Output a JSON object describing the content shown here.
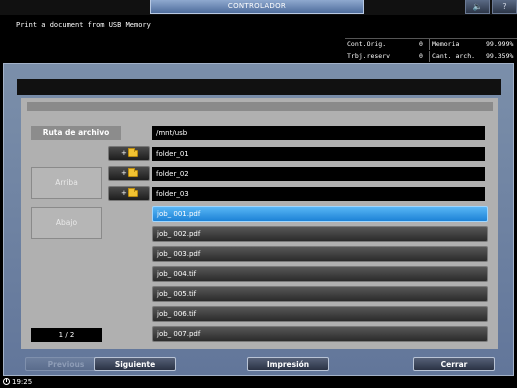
{
  "top_bar": {
    "tab_title": "CONTROLADOR",
    "volume_icon": "speaker-icon",
    "volume_symbol": "🔈",
    "help_symbol": "?"
  },
  "message": "Print a document from USB Memory",
  "status": {
    "rows": [
      {
        "label": "Cont.Orig.",
        "value": "0",
        "label2": "Memoria",
        "value2": "99.999%"
      },
      {
        "label": "Trbj.reserv",
        "value": "0",
        "label2": "Cant. arch.",
        "value2": "99.359%"
      }
    ]
  },
  "browser": {
    "path_label": "Ruta de archivo",
    "path": "/mnt/usb",
    "up_label": "Arriba",
    "down_label": "Abajo",
    "page_indicator": "1 / 2",
    "folder_button_arrow": "+",
    "folders": [
      "folder_01",
      "folder_02",
      "folder_03"
    ],
    "files": [
      {
        "name": "job_ 001.pdf",
        "selected": true
      },
      {
        "name": "job_ 002.pdf",
        "selected": false
      },
      {
        "name": "job_ 003.pdf",
        "selected": false
      },
      {
        "name": "job_ 004.tif",
        "selected": false
      },
      {
        "name": "job_ 005.tif",
        "selected": false
      },
      {
        "name": "job_ 006.tif",
        "selected": false
      },
      {
        "name": "job_ 007.pdf",
        "selected": false
      }
    ]
  },
  "buttons": {
    "previous": "Previous",
    "next": "Siguiente",
    "print": "Impresión",
    "close": "Cerrar"
  },
  "clock": "19:25"
}
